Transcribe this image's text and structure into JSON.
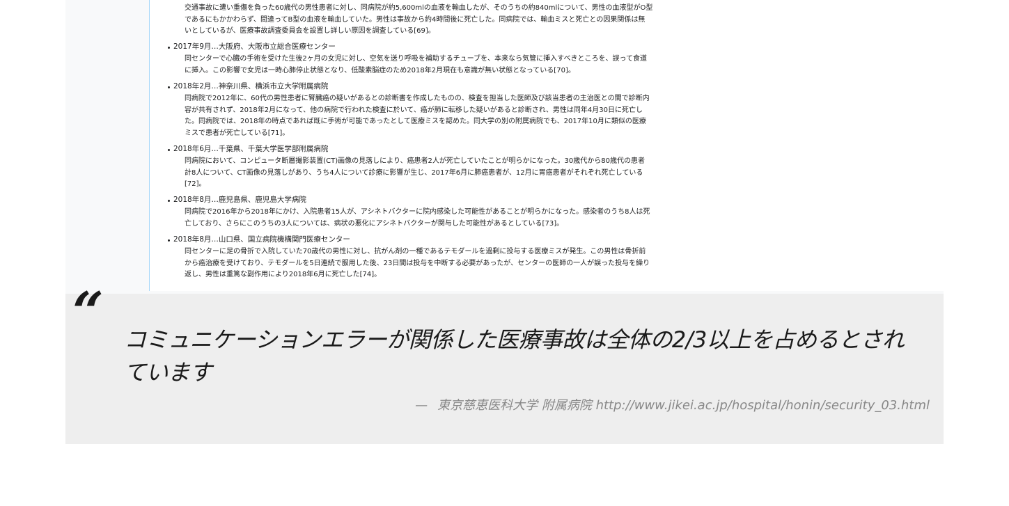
{
  "article": {
    "items": [
      {
        "head": "",
        "lines": [
          "交通事故に遭い重傷を負った60歳代の男性患者に対し、同病院が約5,600mlの血液を輸血したが、そのうちの約840mlについて、男性の血液型がO型",
          "であるにもかかわらず、間違ってB型の血液を輸血していた。男性は事故から約4時間後に死亡した。同病院では、輸血ミスと死亡との因果関係は無",
          "いとしているが、医療事故調査委員会を設置し詳しい原因を調査している[69]。"
        ]
      },
      {
        "head": "2017年9月…大阪府、大阪市立総合医療センター",
        "lines": [
          "同センターで心臓の手術を受けた生後2ヶ月の女児に対し、空気を送り呼吸を補助するチューブを、本来なら気管に挿入すべきところを、誤って食道",
          "に挿入。この影響で女児は一時心肺停止状態となり、低酸素脳症のため2018年2月現在も意識が無い状態となっている[70]。"
        ]
      },
      {
        "head": "2018年2月…神奈川県、横浜市立大学附属病院",
        "lines": [
          "同病院で2012年に、60代の男性患者に腎臓癌の疑いがあるとの診断書を作成したものの、検査を担当した医師及び該当患者の主治医との間で診断内",
          "容が共有されず、2018年2月になって、他の病院で行われた検査に於いて、癌が肺に転移した疑いがあると診断され、男性は同年4月30日に死亡し",
          "た。同病院では、2018年の時点であれば既に手術が可能であったとして医療ミスを認めた。同大学の別の附属病院でも、2017年10月に類似の医療",
          "ミスで患者が死亡している[71]。"
        ]
      },
      {
        "head": "2018年6月…千葉県、千葉大学医学部附属病院",
        "lines": [
          "同病院において、コンピュータ断層撮影装置(CT)画像の見落しにより、癌患者2人が死亡していたことが明らかになった。30歳代から80歳代の患者",
          "計8人について、CT画像の見落しがあり、うち4人について診療に影響が生じ、2017年6月に肺癌患者が、12月に胃癌患者がそれぞれ死亡している",
          "[72]。"
        ]
      },
      {
        "head": "2018年8月…鹿児島県、鹿児島大学病院",
        "lines": [
          "同病院で2016年から2018年にかけ、入院患者15人が、アシネトバクターに院内感染した可能性があることが明らかになった。感染者のうち8人は死",
          "亡しており、さらにこのうちの3人については、病状の悪化にアシネトバクターが関与した可能性があるとしている[73]。"
        ]
      },
      {
        "head": "2018年8月…山口県、国立病院機構関門医療センター",
        "lines": [
          "同センターに足の骨折で入院していた70歳代の男性に対し、抗がん剤の一種であるテモダールを過剰に投与する医療ミスが発生。この男性は骨折前",
          "から癌治療を受けており、テモダールを5日連続で服用した後、23日間は投与を中断する必要があったが、センターの医師の一人が誤った投与を繰り",
          "返し、男性は重篤な副作用により2018年6月に死亡した[74]。"
        ]
      }
    ]
  },
  "quote": {
    "mark": "“",
    "text_line1": "コミュニケーションエラーが関係した医療事故は全体の2/3以上を占めるとされ",
    "text_line2": "ています",
    "dash": "—",
    "source": "東京慈恵医科大学 附属病院 http://www.jikei.ac.jp/hospital/honin/security_03.html"
  },
  "colors": {
    "link": "#0645ad",
    "text": "#202122",
    "quote_bg": "#eeeeee",
    "source": "#888888"
  }
}
